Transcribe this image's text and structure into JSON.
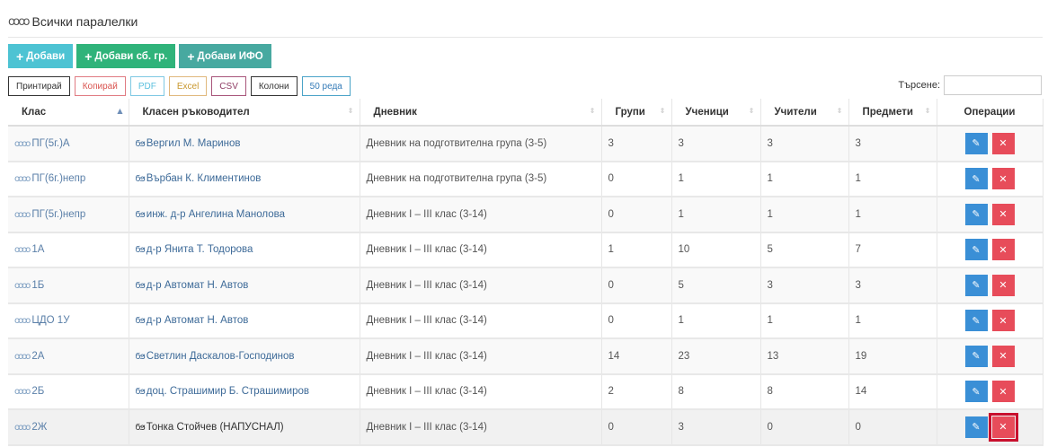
{
  "header": {
    "title": "Всички паралелки",
    "icon": "class-group-icon"
  },
  "actions": {
    "add": "Добави",
    "add_group": "Добави сб. гр.",
    "add_ifo": "Добави ИФО"
  },
  "tools": {
    "print": "Принтирай",
    "copy": "Копирай",
    "pdf": "PDF",
    "excel": "Excel",
    "csv": "CSV",
    "columns": "Колони",
    "rows": "50 реда"
  },
  "search": {
    "label": "Търсене:",
    "value": ""
  },
  "table": {
    "columns": [
      "Клас",
      "Класен ръководител",
      "Дневник",
      "Групи",
      "Ученици",
      "Учители",
      "Предмети",
      "Операции"
    ],
    "rows": [
      {
        "klas": "ПГ(5г.)А",
        "teacher": "Вергил М. Маринов",
        "diary": "Дневник на подготвителна група (3-5)",
        "groups": "3",
        "students": "3",
        "teachers": "3",
        "subjects": "3"
      },
      {
        "klas": "ПГ(6г.)непр",
        "teacher": "Върбан К. Климентинов",
        "diary": "Дневник на подготвителна група (3-5)",
        "groups": "0",
        "students": "1",
        "teachers": "1",
        "subjects": "1"
      },
      {
        "klas": "ПГ(5г.)непр",
        "teacher": "инж. д-р Ангелина Манолова",
        "diary": "Дневник I – III клас (3-14)",
        "groups": "0",
        "students": "1",
        "teachers": "1",
        "subjects": "1"
      },
      {
        "klas": "1А",
        "teacher": "д-р Янита Т. Тодорова",
        "diary": "Дневник I – III клас (3-14)",
        "groups": "1",
        "students": "10",
        "teachers": "5",
        "subjects": "7"
      },
      {
        "klas": "1Б",
        "teacher": "д-р Автомат Н. Автов",
        "diary": "Дневник I – III клас (3-14)",
        "groups": "0",
        "students": "5",
        "teachers": "3",
        "subjects": "3"
      },
      {
        "klas": "ЦДО 1У",
        "teacher": "д-р Автомат Н. Автов",
        "diary": "Дневник I – III клас (3-14)",
        "groups": "0",
        "students": "1",
        "teachers": "1",
        "subjects": "1"
      },
      {
        "klas": "2А",
        "teacher": "Светлин Даскалов-Господинов",
        "diary": "Дневник I – III клас (3-14)",
        "groups": "14",
        "students": "23",
        "teachers": "13",
        "subjects": "19"
      },
      {
        "klas": "2Б",
        "teacher": "доц. Страшимир Б. Страшимиров",
        "diary": "Дневник I – III клас (3-14)",
        "groups": "2",
        "students": "8",
        "teachers": "8",
        "subjects": "14"
      },
      {
        "klas": "2Ж",
        "teacher": "Тонка Стойчев (НАПУСНАЛ)",
        "diary": "Дневник I – III клас (3-14)",
        "groups": "0",
        "students": "3",
        "teachers": "0",
        "subjects": "0"
      }
    ]
  },
  "icons": {
    "edit": "edit-icon",
    "delete": "delete-icon",
    "teacher": "teacher-icon"
  },
  "colors": {
    "edit": "#3a8fd6",
    "delete": "#e74c5a",
    "add": "#4dc3d3",
    "add_group": "#2fb37a",
    "add_ifo": "#47a9a0",
    "link": "#5a7fa8"
  }
}
